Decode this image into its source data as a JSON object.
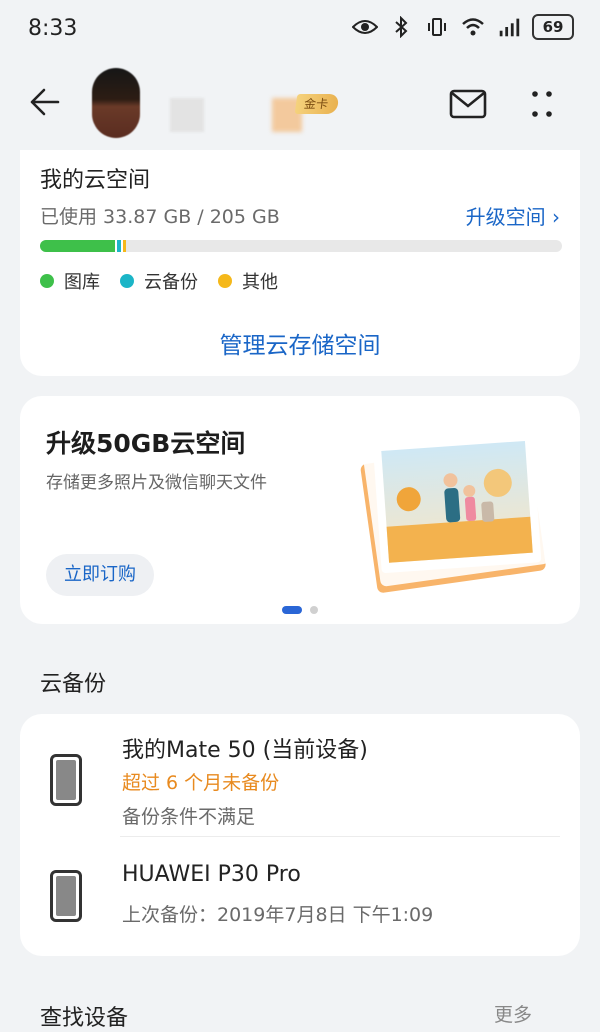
{
  "status_bar": {
    "time": "8:33",
    "battery": "69"
  },
  "header": {
    "badge": "金卡"
  },
  "storage": {
    "title": "我的云空间",
    "usage": "已使用 33.87 GB / 205 GB",
    "upgrade": "升级空间",
    "used_gb": 33.87,
    "total_gb": 205,
    "legend": [
      {
        "label": "图库",
        "color": "#3ec04a"
      },
      {
        "label": "云备份",
        "color": "#1bb5c7"
      },
      {
        "label": "其他",
        "color": "#f5b81a"
      }
    ],
    "manage": "管理云存储空间"
  },
  "promo": {
    "title": "升级50GB云空间",
    "subtitle": "存储更多照片及微信聊天文件",
    "button": "立即订购"
  },
  "backup": {
    "title": "云备份",
    "devices": [
      {
        "name": "我的Mate 50 (当前设备)",
        "warning": "超过 6 个月未备份",
        "meta": "备份条件不满足"
      },
      {
        "name": "HUAWEI P30 Pro",
        "meta": "上次备份：2019年7月8日 下午1:09"
      }
    ]
  },
  "find": {
    "title": "查找设备",
    "more": "更多"
  },
  "colors": {
    "accent": "#1a66c7",
    "warning": "#e88a1f"
  }
}
